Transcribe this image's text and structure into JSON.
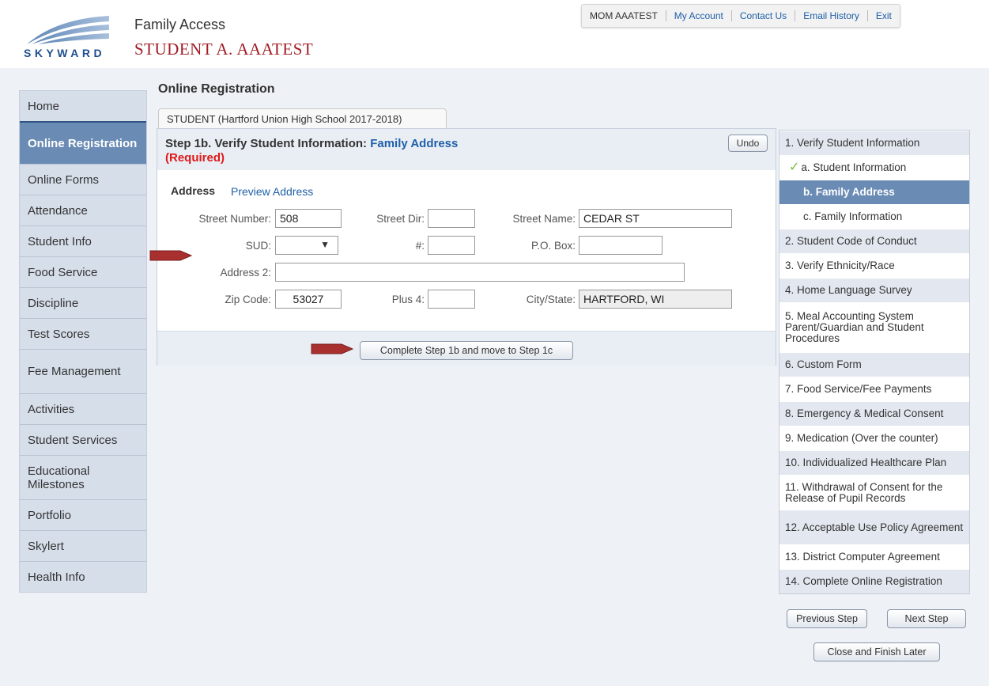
{
  "header": {
    "app_title": "Family Access",
    "student_name": "STUDENT A. AAATEST",
    "logo_text": "SKYWARD",
    "topnav": [
      "MOM AAATEST",
      "My Account",
      "Contact Us",
      "Email History",
      "Exit"
    ]
  },
  "sidebar": {
    "items": [
      {
        "label": "Home",
        "active": false
      },
      {
        "label": "Online Registration",
        "active": true
      },
      {
        "label": "Online Forms",
        "active": false
      },
      {
        "label": "Attendance",
        "active": false
      },
      {
        "label": "Student Info",
        "active": false
      },
      {
        "label": "Food Service",
        "active": false
      },
      {
        "label": "Discipline",
        "active": false
      },
      {
        "label": "Test Scores",
        "active": false
      },
      {
        "label": "Fee Management",
        "active": false
      },
      {
        "label": "Activities",
        "active": false
      },
      {
        "label": "Student Services",
        "active": false
      },
      {
        "label": "Educational Milestones",
        "active": false
      },
      {
        "label": "Portfolio",
        "active": false
      },
      {
        "label": "Skylert",
        "active": false
      },
      {
        "label": "Health Info",
        "active": false
      }
    ]
  },
  "main": {
    "heading": "Online Registration",
    "tab_label": "STUDENT (Hartford Union High School 2017-2018)",
    "step_title": "Step 1b. Verify Student Information:",
    "step_subtitle": "Family Address",
    "required": "(Required)",
    "undo_label": "Undo",
    "address_label": "Address",
    "preview_link": "Preview Address",
    "fields": {
      "street_number": {
        "label": "Street Number:",
        "value": "508"
      },
      "street_dir": {
        "label": "Street Dir:",
        "value": ""
      },
      "street_name": {
        "label": "Street Name:",
        "value": "CEDAR ST"
      },
      "sud": {
        "label": "SUD:",
        "value": ""
      },
      "unit_number": {
        "label": "#:",
        "value": ""
      },
      "po_box": {
        "label": "P.O. Box:",
        "value": ""
      },
      "address2": {
        "label": "Address 2:",
        "value": ""
      },
      "zip_code": {
        "label": "Zip Code:",
        "value": "53027"
      },
      "plus4": {
        "label": "Plus 4:",
        "value": ""
      },
      "city_state": {
        "label": "City/State:",
        "value": "HARTFORD, WI"
      }
    },
    "complete_button": "Complete Step 1b and move to Step 1c"
  },
  "steps": {
    "items": [
      {
        "label": "1. Verify Student Information",
        "kind": "main"
      },
      {
        "label": "a. Student Information",
        "kind": "sub",
        "done": true
      },
      {
        "label": "b. Family Address",
        "kind": "sub",
        "active": true
      },
      {
        "label": "c. Family Information",
        "kind": "sub"
      },
      {
        "label": "2. Student Code of Conduct",
        "kind": "main"
      },
      {
        "label": "3. Verify Ethnicity/Race",
        "kind": "main"
      },
      {
        "label": "4. Home Language Survey",
        "kind": "main"
      },
      {
        "label": "5. Meal Accounting System Parent/Guardian and Student Procedures",
        "kind": "main"
      },
      {
        "label": "6. Custom Form",
        "kind": "main"
      },
      {
        "label": "7. Food Service/Fee Payments",
        "kind": "main"
      },
      {
        "label": "8. Emergency & Medical Consent",
        "kind": "main"
      },
      {
        "label": "9. Medication (Over the counter)",
        "kind": "main"
      },
      {
        "label": "10. Individualized Healthcare Plan",
        "kind": "main"
      },
      {
        "label": "11. Withdrawal of Consent for the Release of Pupil Records",
        "kind": "main"
      },
      {
        "label": "12. Acceptable Use Policy Agreement",
        "kind": "main"
      },
      {
        "label": "13. District Computer Agreement",
        "kind": "main"
      },
      {
        "label": "14. Complete Online Registration",
        "kind": "main"
      }
    ],
    "previous_button": "Previous Step",
    "next_button": "Next Step",
    "close_button": "Close and Finish Later"
  },
  "colors": {
    "brand_red": "#a01c24",
    "link_blue": "#1f5fa8",
    "active_blue": "#6a8bb4",
    "required_red": "#e01919",
    "arrow_red": "#a8302e"
  }
}
